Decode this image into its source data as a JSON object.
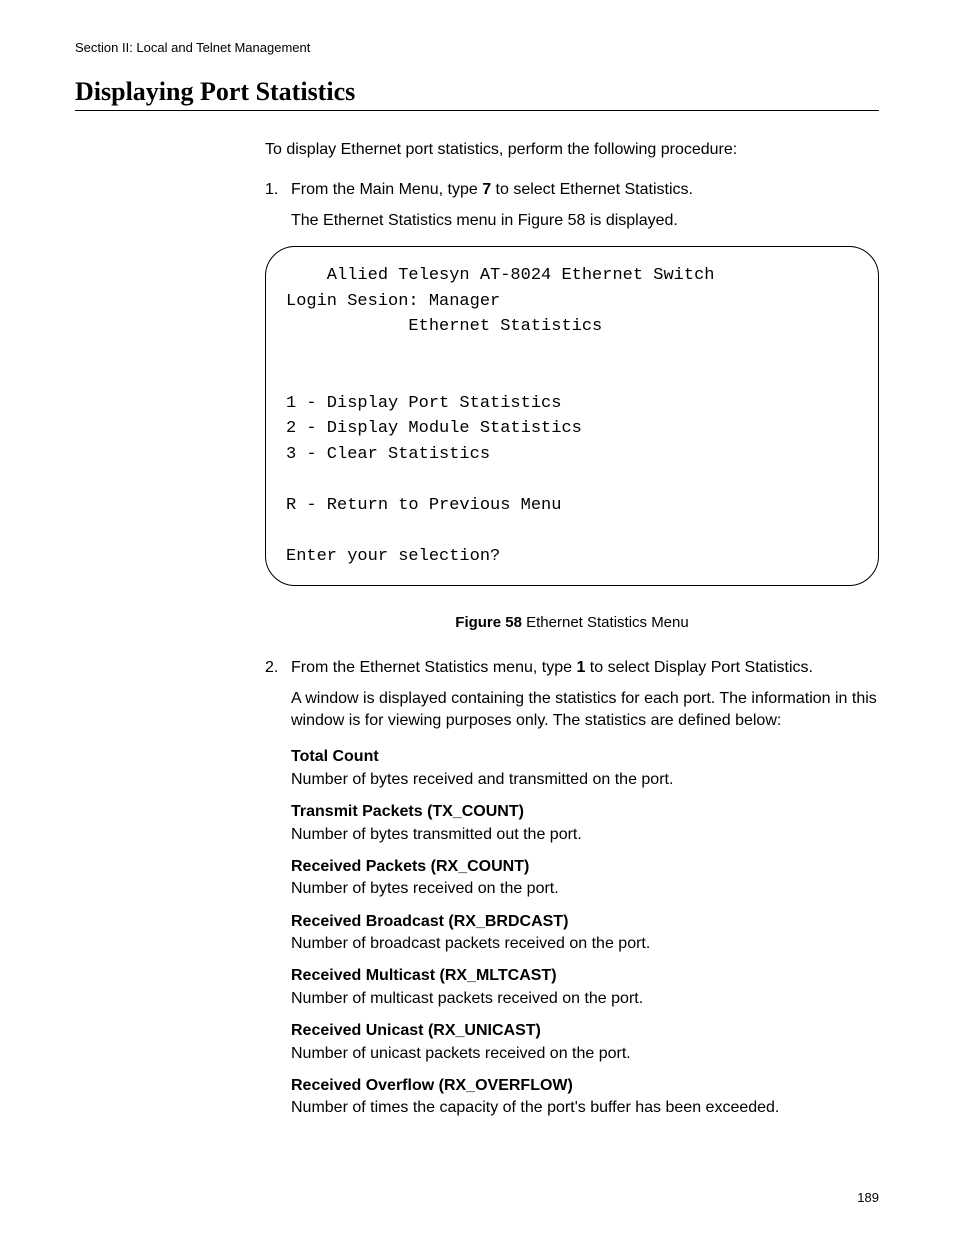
{
  "header": "Section II: Local and Telnet Management",
  "title": "Displaying Port Statistics",
  "intro": "To display Ethernet port statistics, perform the following procedure:",
  "step1": {
    "number": "1.",
    "textA": "From the Main Menu, type ",
    "bold": "7",
    "textB": " to select Ethernet Statistics.",
    "body": "The Ethernet Statistics menu in Figure 58 is displayed."
  },
  "terminal": {
    "line1": "    Allied Telesyn AT-8024 Ethernet Switch",
    "line2": "Login Sesion: Manager",
    "line3": "            Ethernet Statistics",
    "line4": "",
    "line5": "",
    "line6": "1 - Display Port Statistics",
    "line7": "2 - Display Module Statistics",
    "line8": "3 - Clear Statistics",
    "line9": "",
    "line10": "R - Return to Previous Menu",
    "line11": "",
    "line12": "Enter your selection?"
  },
  "figureCaption": {
    "bold": "Figure 58",
    "text": "  Ethernet Statistics Menu"
  },
  "step2": {
    "number": "2.",
    "textA": "From the Ethernet Statistics menu, type ",
    "bold": "1",
    "textB": " to select Display Port Statistics.",
    "body": "A window is displayed containing the statistics for each port. The information in this window is for viewing purposes only. The statistics are defined below:"
  },
  "defs": [
    {
      "term": "Total Count",
      "text": "Number of bytes received and transmitted on the port."
    },
    {
      "term": "Transmit Packets (TX_COUNT)",
      "text": "Number of bytes transmitted out the port."
    },
    {
      "term": "Received Packets (RX_COUNT)",
      "text": "Number of bytes received on the port."
    },
    {
      "term": "Received Broadcast (RX_BRDCAST)",
      "text": "Number of broadcast packets received on the port."
    },
    {
      "term": "Received Multicast (RX_MLTCAST)",
      "text": "Number of multicast packets received on the port."
    },
    {
      "term": "Received Unicast (RX_UNICAST)",
      "text": "Number of unicast packets received on the port."
    },
    {
      "term": "Received Overflow (RX_OVERFLOW)",
      "text": "Number of times the capacity of the port's buffer has been exceeded."
    }
  ],
  "pageNumber": "189"
}
